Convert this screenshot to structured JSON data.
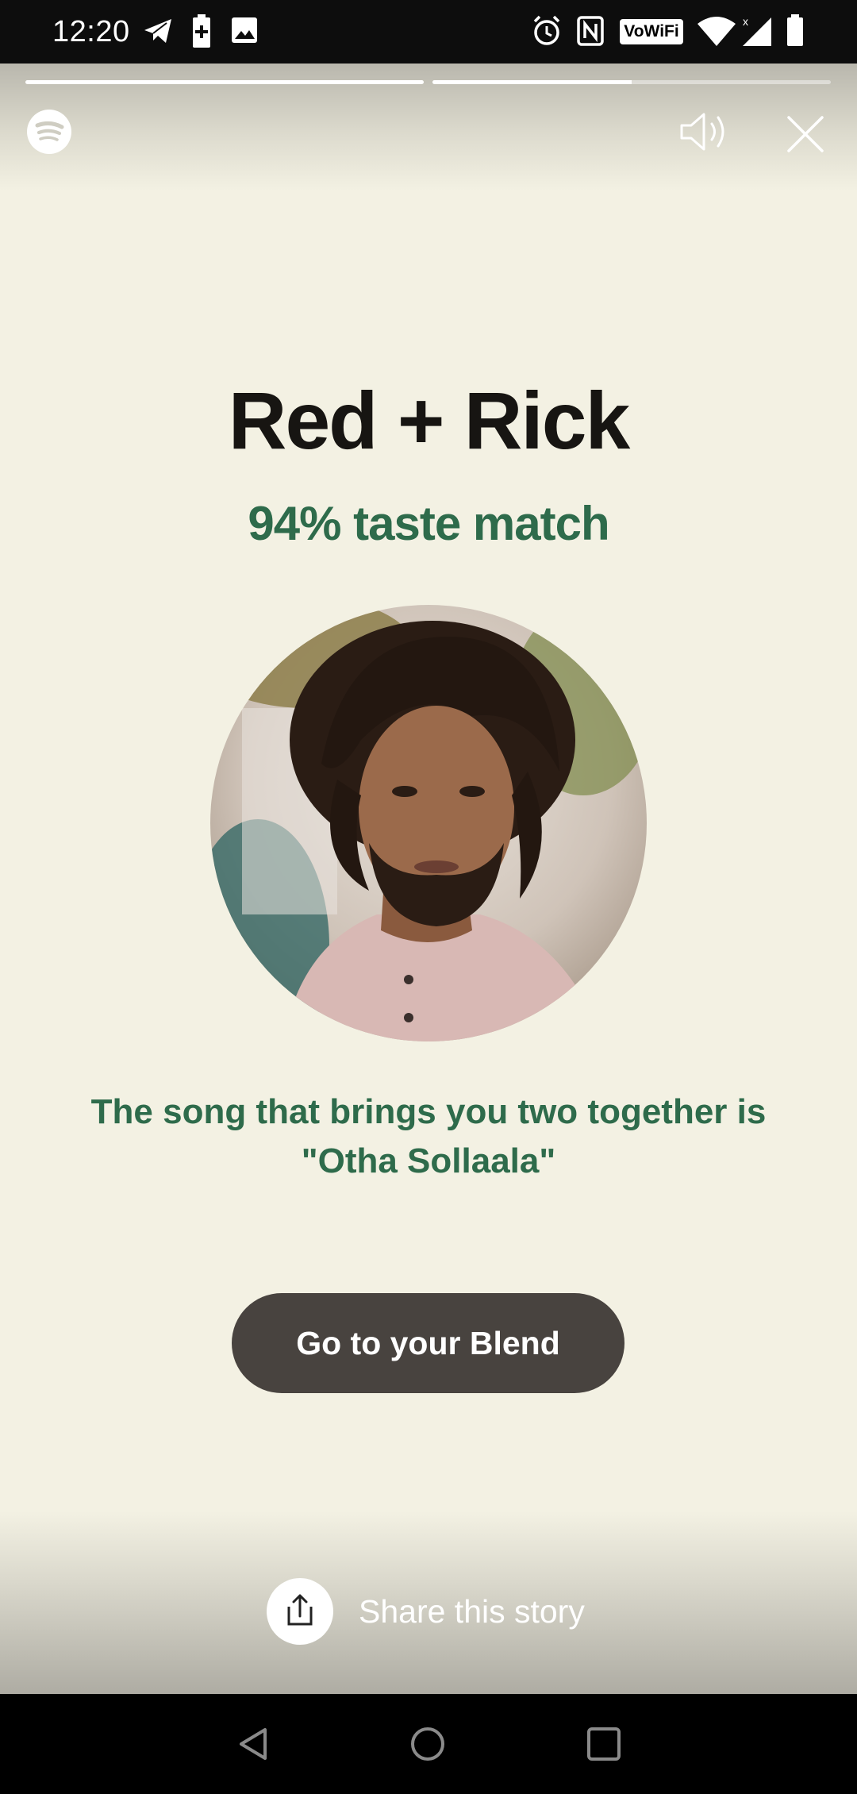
{
  "status_bar": {
    "time": "12:20",
    "left_icons": [
      "telegram-icon",
      "battery-saver-icon",
      "image-icon"
    ],
    "right_icons": [
      "alarm-icon",
      "nfc-icon",
      "vowifi-badge",
      "wifi-icon",
      "signal-icon",
      "battery-icon"
    ],
    "vowifi_label": "VoWiFi"
  },
  "story": {
    "background_color": "#f3f1e3",
    "progress": [
      1.0,
      0.5
    ],
    "title": "Red + Rick",
    "match": "94% taste match",
    "song_line": "The song that brings you two together is \"Otha Sollaala\"",
    "button_label": "Go to your Blend",
    "share_label": "Share this story",
    "accent_color": "#2e6b4b",
    "button_color": "#48433f"
  },
  "icons": {
    "logo": "spotify-logo-icon",
    "sound": "speaker-icon",
    "close": "close-icon",
    "share": "share-icon"
  },
  "nav_bar": {
    "buttons": [
      "back-icon",
      "home-icon",
      "recents-icon"
    ]
  }
}
